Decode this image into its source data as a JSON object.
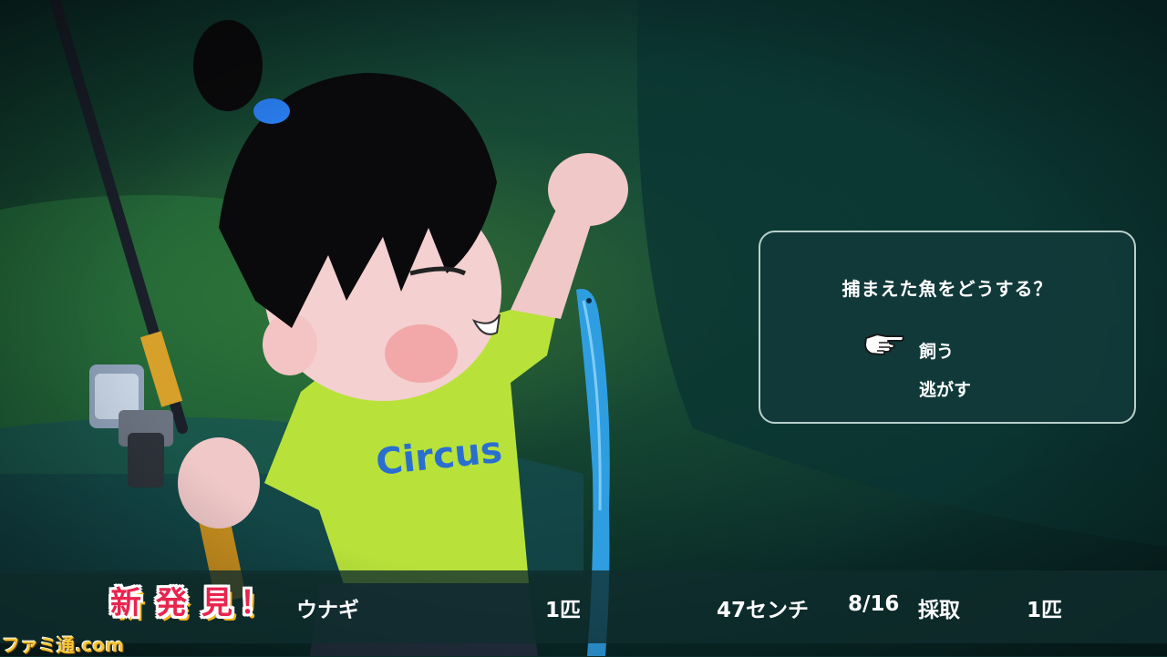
{
  "dialog": {
    "question": "捕まえた魚をどうする？",
    "options": [
      "飼う",
      "逃がす"
    ],
    "selected_index": 0
  },
  "catch_info": {
    "badge": [
      "新",
      "発",
      "見",
      "！"
    ],
    "fish_name": "ウナギ",
    "count": "1匹",
    "size": "47センチ",
    "date": "8/16",
    "action": "採取",
    "collected": "1匹"
  },
  "character": {
    "shirt_text": "Circus"
  },
  "watermark": "ファミ通.com",
  "colors": {
    "shirt": "#b8e23a",
    "fish": "#2f9ee0",
    "badge_red": "#e8244e",
    "dialog_bg": "#123a3a"
  }
}
